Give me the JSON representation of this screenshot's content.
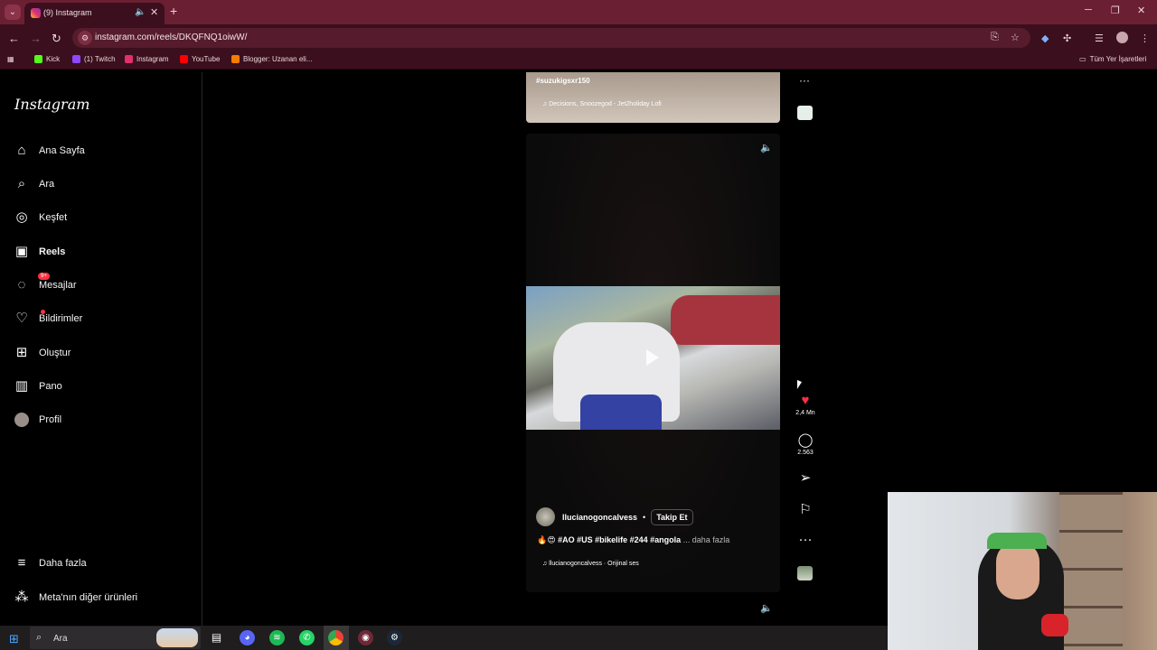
{
  "browser": {
    "tab_title": "(9) Instagram",
    "url": "instagram.com/reels/DKQFNQ1oiwW/",
    "new_tab": "+",
    "tab_list": "⌄",
    "window_controls": [
      "─",
      "❐",
      "✕"
    ],
    "bookmarks": [
      {
        "label": "Kick",
        "color": "#53fc18"
      },
      {
        "label": "(1) Twitch",
        "color": "#9146ff"
      },
      {
        "label": "Instagram",
        "color": "#e1306c"
      },
      {
        "label": "YouTube",
        "color": "#ff0000"
      },
      {
        "label": "Blogger: Uzanan eli...",
        "color": "#f57d00"
      }
    ],
    "all_bookmarks": "Tüm Yer İşaretleri"
  },
  "sidebar": {
    "logo": "Instagram",
    "items": [
      {
        "label": "Ana Sayfa",
        "icon": "home-icon"
      },
      {
        "label": "Ara",
        "icon": "search-icon"
      },
      {
        "label": "Keşfet",
        "icon": "compass-icon"
      },
      {
        "label": "Reels",
        "icon": "reels-icon"
      },
      {
        "label": "Mesajlar",
        "icon": "messenger-icon",
        "badge": "9+"
      },
      {
        "label": "Bildirimler",
        "icon": "heart-icon"
      },
      {
        "label": "Oluştur",
        "icon": "plus-square-icon"
      },
      {
        "label": "Pano",
        "icon": "chart-icon"
      },
      {
        "label": "Profil",
        "icon": "avatar-icon"
      }
    ],
    "more": "Daha fazla",
    "meta": "Meta'nın diğer ürünleri"
  },
  "reel_prev": {
    "tag": "#suzukigsxr150",
    "music": "Decisions, Snoozegod - Jet2holiday Lofi"
  },
  "reel": {
    "author": "llucianogoncalvess",
    "separator": "•",
    "follow": "Takip Et",
    "caption_emoji": "🔥😍",
    "caption_tags": "#AO #US #bikelife #244 #angola ",
    "caption_more": "... daha fazla",
    "audio": "llucianogoncalvess · Orijinal ses",
    "likes": "2,4 Mn",
    "comments": "2.563"
  },
  "taskbar": {
    "search": "Ara"
  },
  "colors": {
    "tabbar": "#6b1f33",
    "toolbar": "#3b0f1d",
    "like": "#ff3040"
  }
}
